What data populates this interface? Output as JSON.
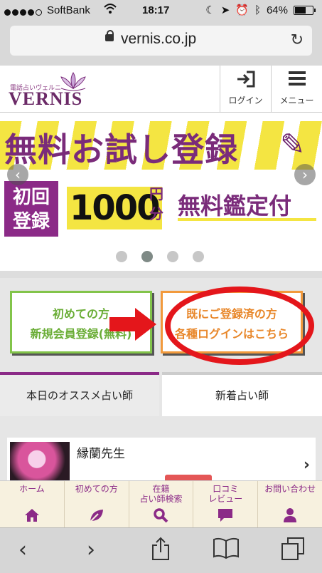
{
  "status_bar": {
    "carrier": "SoftBank",
    "time": "18:17",
    "battery": "64%",
    "battery_level": 0.64
  },
  "browser": {
    "url": "vernis.co.jp"
  },
  "site_header": {
    "logo_small": "電話占いヴェルニ",
    "logo_name": "VERNIS",
    "login_label": "ログイン",
    "menu_label": "メニュー"
  },
  "banner": {
    "title": "無料お試し登録",
    "badge_line1": "初回",
    "badge_line2": "登録",
    "amount": "1000",
    "unit_line1": "円",
    "unit_line2": "分",
    "free_text": "無料鑑定付"
  },
  "carousel": {
    "slide_count": 4,
    "active_index": 1
  },
  "registration": {
    "new_line1": "初めての方",
    "new_line2": "新規会員登録(無料)",
    "existing_line1": "既にご登録済の方",
    "existing_line2": "各種ログインはこちら"
  },
  "tabs": [
    {
      "label": "本日のオススメ占い師",
      "active": true
    },
    {
      "label": "新着占い師",
      "active": false
    }
  ],
  "teachers": [
    {
      "name": "縁蘭先生"
    }
  ],
  "site_nav": [
    {
      "line1": "ホーム",
      "line2": "",
      "icon": "home-icon"
    },
    {
      "line1": "初めての方",
      "line2": "",
      "icon": "leaf-icon"
    },
    {
      "line1": "在籍",
      "line2": "占い師検索",
      "icon": "search-icon"
    },
    {
      "line1": "口コミ",
      "line2": "レビュー",
      "icon": "chat-icon"
    },
    {
      "line1": "お問い合わせ",
      "line2": "",
      "icon": "person-icon"
    }
  ],
  "colors": {
    "brand_purple": "#8b2a87",
    "banner_yellow": "#f4e542",
    "new_green": "#82c44a",
    "existing_orange": "#f29a3c",
    "annotation_red": "#e4161b"
  }
}
